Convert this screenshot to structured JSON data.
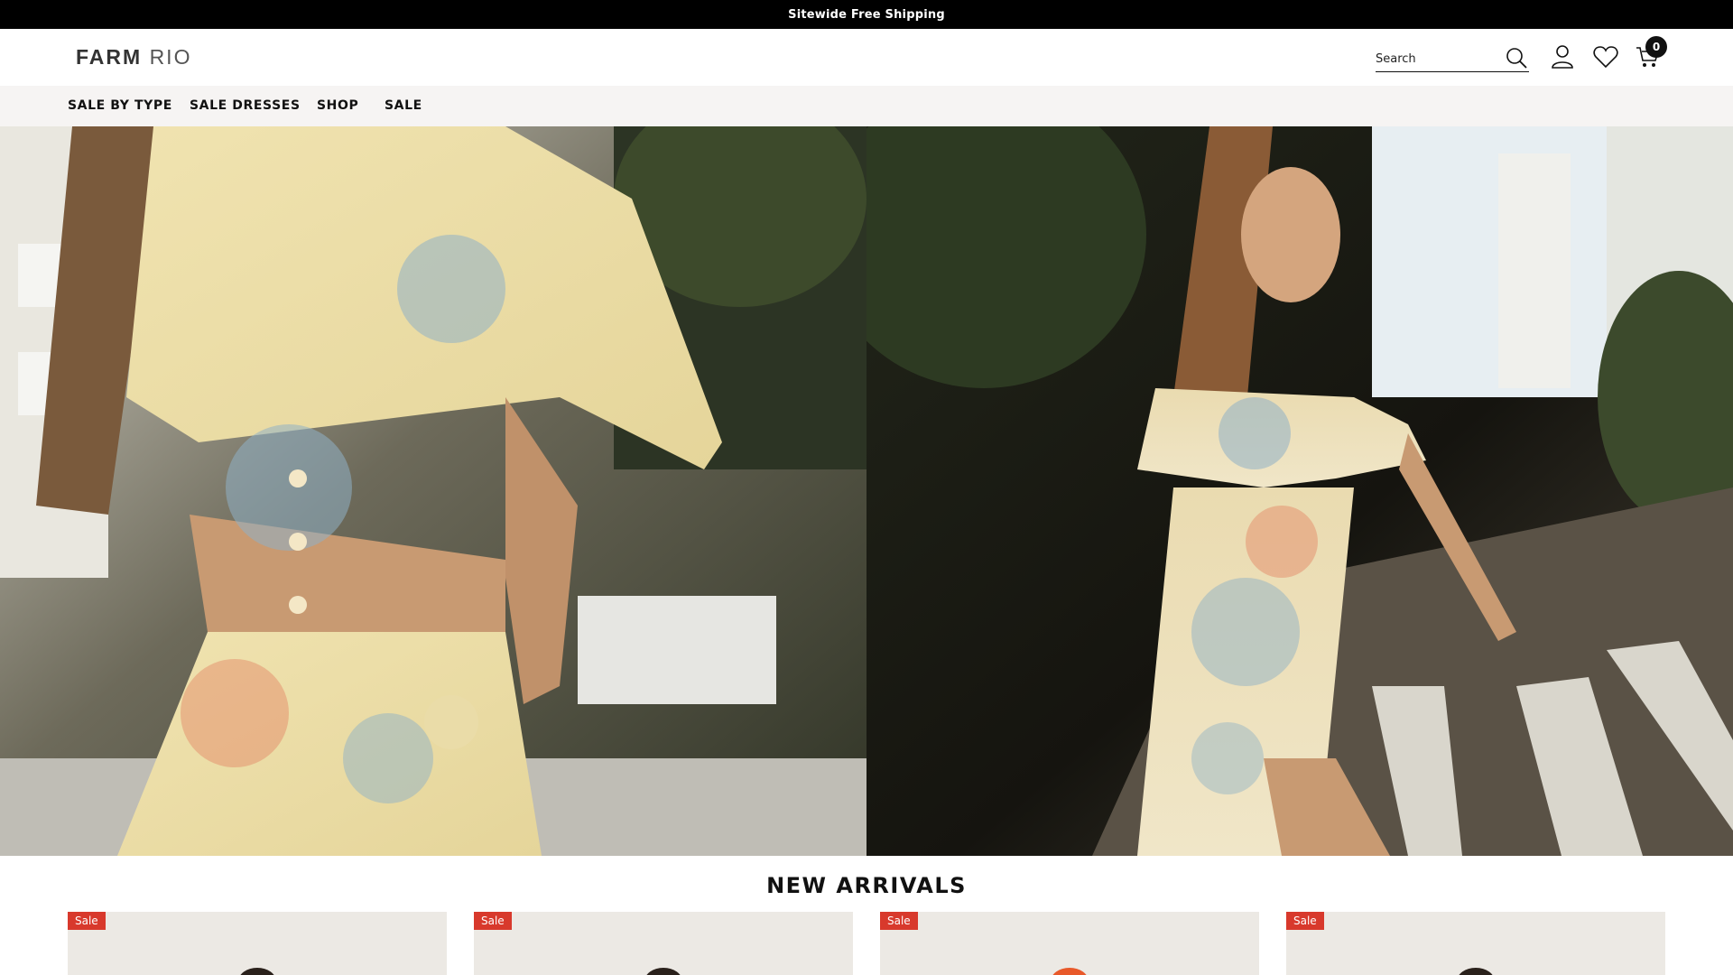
{
  "promo": {
    "text": "Sitewide Free Shipping"
  },
  "header": {
    "logo_bold": "FARM",
    "logo_light": "RIO",
    "search_placeholder": "Search",
    "cart_count": "0",
    "icons": {
      "search": "search-icon",
      "account": "user-icon",
      "wishlist": "heart-icon",
      "cart": "cart-icon"
    }
  },
  "nav": {
    "items": [
      {
        "label": "SALE BY TYPE"
      },
      {
        "label": "SALE DRESSES"
      },
      {
        "label": "SHOP"
      },
      {
        "label": "SALE"
      }
    ]
  },
  "new_arrivals": {
    "title": "NEW ARRIVALS",
    "products": [
      {
        "badge": "Sale"
      },
      {
        "badge": "Sale"
      },
      {
        "badge": "Sale"
      },
      {
        "badge": "Sale"
      }
    ]
  },
  "colors": {
    "promo_bg": "#000000",
    "nav_bg": "#f6f4f3",
    "sale_badge": "#d8392c",
    "cart_badge": "#111111"
  }
}
